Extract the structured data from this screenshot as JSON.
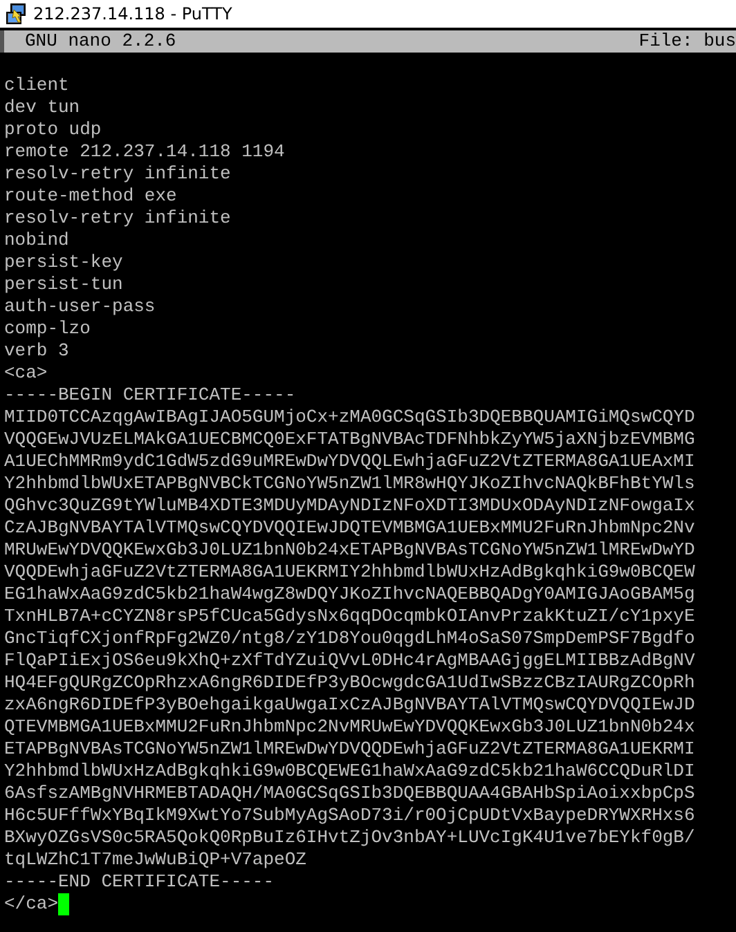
{
  "window": {
    "title": "212.237.14.118 - PuTTY"
  },
  "nano_header": {
    "version": "GNU nano 2.2.6",
    "file": "File: bus"
  },
  "editor": {
    "cursor_visible": true,
    "lines": [
      "client",
      "dev tun",
      "proto udp",
      "remote 212.237.14.118 1194",
      "resolv-retry infinite",
      "route-method exe",
      "resolv-retry infinite",
      "nobind",
      "persist-key",
      "persist-tun",
      "auth-user-pass",
      "comp-lzo",
      "verb 3",
      "<ca>",
      "-----BEGIN CERTIFICATE-----",
      "MIID0TCCAzqgAwIBAgIJAO5GUMjoCx+zMA0GCSqGSIb3DQEBBQUAMIGiMQswCQYD",
      "VQQGEwJVUzELMAkGA1UECBMCQ0ExFTATBgNVBAcTDFNhbkZyYW5jaXNjbzEVMBMG",
      "A1UEChMMRm9ydC1GdW5zdG9uMREwDwYDVQQLEwhjaGFuZ2VtZTERMA8GA1UEAxMI",
      "Y2hhbmdlbWUxETAPBgNVBCkTCGNoYW5nZW1lMR8wHQYJKoZIhvcNAQkBFhBtYWls",
      "QGhvc3QuZG9tYWluMB4XDTE3MDUyMDAyNDIzNFoXDTI3MDUxODAyNDIzNFowgaIx",
      "CzAJBgNVBAYTAlVTMQswCQYDVQQIEwJDQTEVMBMGA1UEBxMMU2FuRnJhbmNpc2Nv",
      "MRUwEwYDVQQKEwxGb3J0LUZ1bnN0b24xETAPBgNVBAsTCGNoYW5nZW1lMREwDwYD",
      "VQQDEwhjaGFuZ2VtZTERMA8GA1UEKRMIY2hhbmdlbWUxHzAdBgkqhkiG9w0BCQEW",
      "EG1haWxAaG9zdC5kb21haW4wgZ8wDQYJKoZIhvcNAQEBBQADgY0AMIGJAoGBAM5g",
      "TxnHLB7A+cCYZN8rsP5fCUca5GdysNx6qqDOcqmbkOIAnvPrzakKtuZI/cY1pxyE",
      "GncTiqfCXjonfRpFg2WZ0/ntg8/zY1D8You0qgdLhM4oSaS07SmpDemPSF7Bgdfo",
      "FlQaPIiExjOS6eu9kXhQ+zXfTdYZuiQVvL0DHc4rAgMBAAGjggELMIIBBzAdBgNV",
      "HQ4EFgQURgZCOpRhzxA6ngR6DIDEfP3yBOcwgdcGA1UdIwSBzzCBzIAURgZCOpRh",
      "zxA6ngR6DIDEfP3yBOehgaikgaUwgaIxCzAJBgNVBAYTAlVTMQswCQYDVQQIEwJD",
      "QTEVMBMGA1UEBxMMU2FuRnJhbmNpc2NvMRUwEwYDVQQKEwxGb3J0LUZ1bnN0b24x",
      "ETAPBgNVBAsTCGNoYW5nZW1lMREwDwYDVQQDEwhjaGFuZ2VtZTERMA8GA1UEKRMI",
      "Y2hhbmdlbWUxHzAdBgkqhkiG9w0BCQEWEG1haWxAaG9zdC5kb21haW6CCQDuRlDI",
      "6AsfszAMBgNVHRMEBTADAQH/MA0GCSqGSIb3DQEBBQUAA4GBAHbSpiAoixxbpCpS",
      "H6c5UFffWxYBqIkM9XwtYo7SubMyAgSAoD73i/r0OjCpUDtVxBaypeDRYWXRHxs6",
      "BXwyOZGsVS0c5RA5QokQ0RpBuIz6IHvtZjOv3nbAY+LUVcIgK4U1ve7bEYkf0gB/",
      "tqLWZhC1T7meJwWuBiQP+V7apeOZ",
      "-----END CERTIFICATE-----",
      "</ca>"
    ]
  }
}
